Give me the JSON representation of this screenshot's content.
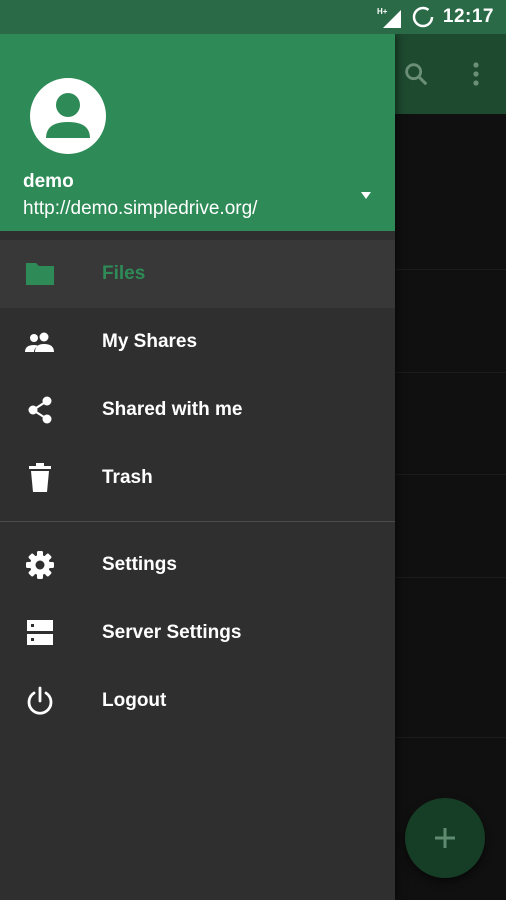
{
  "status_bar": {
    "network": "H+",
    "time": "12:17"
  },
  "drawer": {
    "account": {
      "name": "demo",
      "server": "http://demo.simpledrive.org/"
    },
    "primary_items": [
      {
        "label": "Files",
        "icon": "folder-icon",
        "active": true
      },
      {
        "label": "My Shares",
        "icon": "people-icon",
        "active": false
      },
      {
        "label": "Shared with me",
        "icon": "share-icon",
        "active": false
      },
      {
        "label": "Trash",
        "icon": "trash-icon",
        "active": false
      }
    ],
    "secondary_items": [
      {
        "label": "Settings",
        "icon": "gear-icon"
      },
      {
        "label": "Server Settings",
        "icon": "server-icon"
      },
      {
        "label": "Logout",
        "icon": "power-icon"
      }
    ]
  },
  "colors": {
    "primary": "#2e8b57",
    "primary_dark": "#2b6a46",
    "drawer_bg": "#2f2f2f"
  }
}
